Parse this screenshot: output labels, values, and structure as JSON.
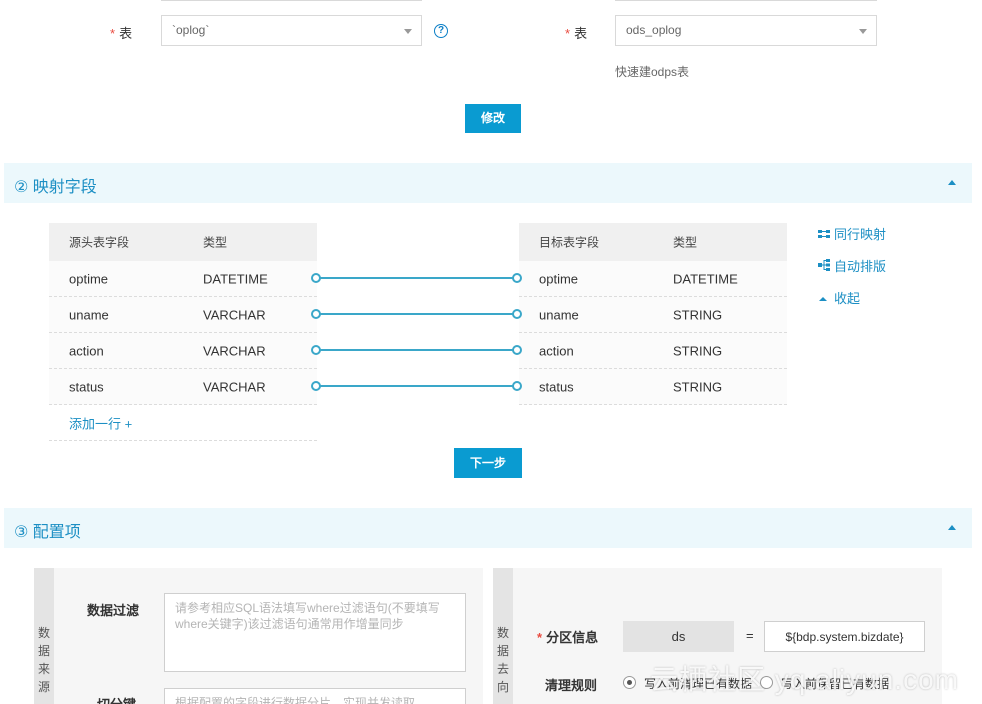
{
  "top_form": {
    "source": {
      "required_mark": "*",
      "label": "表",
      "value": "`oplog`"
    },
    "target": {
      "required_mark": "*",
      "label": "表",
      "value": "ods_oplog",
      "hint": "快速建odps表"
    },
    "help_glyph": "?",
    "modify_button": "修改"
  },
  "section_mapping": {
    "title": "② 映射字段",
    "source_table": {
      "headers": [
        "源头表字段",
        "类型"
      ],
      "rows": [
        {
          "field": "optime",
          "type": "DATETIME"
        },
        {
          "field": "uname",
          "type": "VARCHAR"
        },
        {
          "field": "action",
          "type": "VARCHAR"
        },
        {
          "field": "status",
          "type": "VARCHAR"
        }
      ],
      "add_row": "添加一行 +"
    },
    "target_table": {
      "headers": [
        "目标表字段",
        "类型"
      ],
      "rows": [
        {
          "field": "optime",
          "type": "DATETIME"
        },
        {
          "field": "uname",
          "type": "STRING"
        },
        {
          "field": "action",
          "type": "STRING"
        },
        {
          "field": "status",
          "type": "STRING"
        }
      ]
    },
    "side_links": [
      "同行映射",
      "自动排版",
      "收起"
    ],
    "next_button": "下一步"
  },
  "section_config": {
    "title": "③ 配置项",
    "source_tab": "数据来源",
    "target_tab": "数据去向",
    "data_filter": {
      "label": "数据过滤",
      "placeholder": "请参考相应SQL语法填写where过滤语句(不要填写where关键字)该过滤语句通常用作增量同步"
    },
    "split_key": {
      "label": "切分键",
      "placeholder": "根据配置的字段进行数据分片，实现并发读取"
    },
    "partition": {
      "required_mark": "*",
      "label": "分区信息",
      "key": "ds",
      "equals": "=",
      "value": "${bdp.system.bizdate}"
    },
    "clean_rule": {
      "label": "清理规则",
      "options": [
        "写入前清理已有数据",
        "写入前保留已有数据"
      ],
      "selected": 0
    }
  },
  "watermark": "云栖社区 yq.aliyun.com",
  "colors": {
    "accent": "#0a9bd1",
    "link": "#1c8fc4",
    "section_bg": "#ecf8fc",
    "required": "#e94a3f"
  }
}
